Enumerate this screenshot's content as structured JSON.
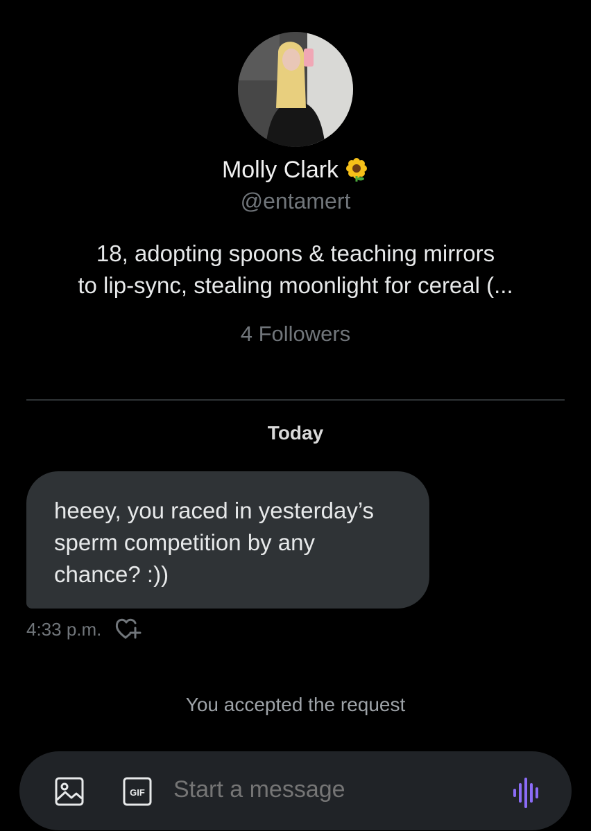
{
  "profile": {
    "name": "Molly Clark",
    "name_emoji": "sunflower-icon",
    "handle": "@entamert",
    "bio_lines": [
      "18, adopting spoons & teaching mirrors",
      "to lip-sync, stealing moonlight for cereal (..."
    ],
    "followers": "4 Followers"
  },
  "conversation": {
    "day_label": "Today",
    "message": {
      "lines": [
        "heeey, you raced in yesterday’s",
        "sperm competition by any",
        "chance? :))"
      ],
      "time": "4:33 p.m."
    },
    "system_notice": "You accepted the request"
  },
  "composer": {
    "placeholder": "Start a message",
    "gif_label": "GIF"
  },
  "colors": {
    "background": "#000000",
    "bubble": "#2f3336",
    "muted_text": "#71767b",
    "voice_accent": "#8b6cf6"
  }
}
